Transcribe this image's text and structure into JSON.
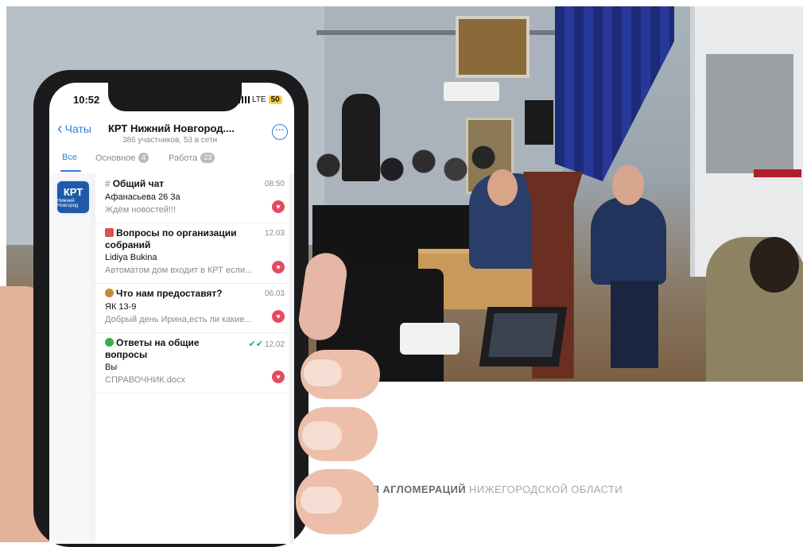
{
  "status_bar": {
    "time": "10:52",
    "network": "LTE",
    "battery": "50"
  },
  "header": {
    "back_label": "Чаты",
    "title": "КРТ Нижний Новгород....",
    "subtitle": "386 участников, 53 в сети"
  },
  "tabs": [
    {
      "label": "Все",
      "badge": ""
    },
    {
      "label": "Основное",
      "badge": "4"
    },
    {
      "label": "Работа",
      "badge": "23"
    }
  ],
  "group_avatar": {
    "label": "КРТ",
    "sublabel": "Нижний Новгород"
  },
  "topics": [
    {
      "title": "Общий чат",
      "time": "08:50",
      "sender": "Афанасьева 26 3а",
      "preview": "Ждём новостей!!!"
    },
    {
      "title": "Вопросы по организации собраний",
      "time": "12.03",
      "sender": "Lidiya Bukina",
      "preview": "Автоматом дом входит в КРТ если..."
    },
    {
      "title": "Что нам предоставят?",
      "time": "06.03",
      "sender": "ЯК 13-9",
      "preview": "Добрый день Ирина,есть ли какие..."
    },
    {
      "title": "Ответы на общие вопросы",
      "time": "12.02",
      "sender": "Вы",
      "preview": "СПРАВОЧНИК.docx"
    }
  ],
  "caption": {
    "bold": "ВИТИЯ АГЛОМЕРАЦИЙ",
    "rest": " НИЖЕГОРОДСКОЙ ОБЛАСТИ"
  },
  "colors": {
    "accent": "#2f7ee6",
    "badge": "#e64a5f",
    "avatar": "#1f5aa8"
  }
}
